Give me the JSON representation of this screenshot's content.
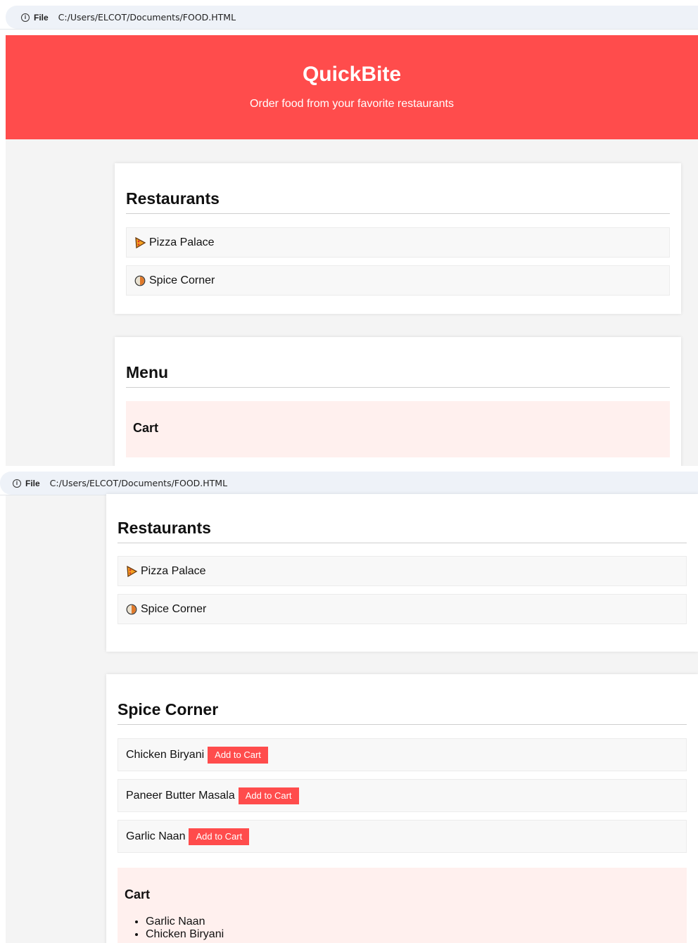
{
  "browser": {
    "info_label": "File",
    "url": "C:/Users/ELCOT/Documents/FOOD.HTML"
  },
  "header": {
    "title": "QuickBite",
    "subtitle": "Order food from your favorite restaurants"
  },
  "restaurants": {
    "heading": "Restaurants",
    "items": [
      {
        "name": "Pizza Palace",
        "icon": "pizza-icon"
      },
      {
        "name": "Spice Corner",
        "icon": "curry-icon"
      }
    ]
  },
  "menu": {
    "heading_initial": "Menu",
    "heading_selected": "Spice Corner",
    "add_label": "Add to Cart",
    "items": [
      {
        "name": "Chicken Biryani"
      },
      {
        "name": "Paneer Butter Masala"
      },
      {
        "name": "Garlic Naan"
      }
    ]
  },
  "cart": {
    "heading": "Cart",
    "items": [
      "Garlic Naan",
      "Chicken Biryani"
    ]
  },
  "colors": {
    "brand": "#ff4c4c",
    "cart_bg": "#fff0ee",
    "page_bg": "#f4f4f4"
  }
}
